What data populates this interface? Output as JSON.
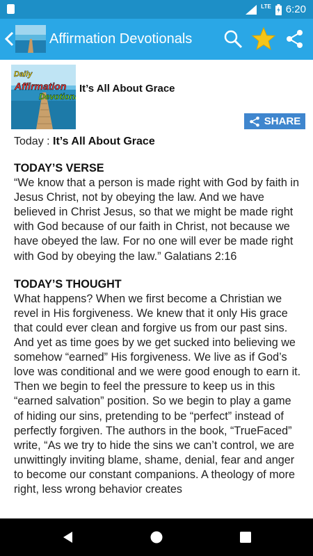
{
  "status_bar": {
    "network": "LTE",
    "time": "6:20"
  },
  "app_bar": {
    "title": "Affirmation Devotionals"
  },
  "logo": {
    "line1": "Daily",
    "line2": "Affirmation",
    "line3": "Devotional"
  },
  "header": {
    "title": "It’s All About Grace",
    "share_label": "SHARE"
  },
  "today": {
    "prefix": "Today : ",
    "title": "It’s All About Grace"
  },
  "verse": {
    "heading": "TODAY’S VERSE",
    "text": "“We know that a person is made right with God by faith in Jesus Christ, not by obeying the law. And we have believed in Christ Jesus, so that we might be made right with God because of our faith in Christ, not because we have obeyed the law. For no one will ever be made right with God by obeying the law.” Galatians 2:16"
  },
  "thought": {
    "heading": "TODAY’S THOUGHT",
    "text": "What happens? When we first become a Christian we revel in His forgiveness. We knew that it only His grace that could ever clean and forgive us from our past sins. And yet as time goes by we get sucked into believing we somehow “earned” His forgiveness. We live as if God’s love was conditional and we were good enough to earn it. Then we begin to feel the pressure to keep us in this “earned salvation” position. So we begin to play a game of hiding our sins, pretending to be “perfect” instead of perfectly forgiven. The authors in the book, “TrueFaced” write, “As we try to hide the sins we can’t control, we are unwittingly inviting blame, shame, denial, fear and anger to become our constant companions. A theology of more right, less wrong behavior creates"
  },
  "icons": {
    "back": "back-arrow-icon",
    "search": "search-icon",
    "favorite": "star-icon",
    "share": "share-icon",
    "nav_back": "nav-back-icon",
    "nav_home": "nav-home-icon",
    "nav_recents": "nav-recents-icon"
  },
  "colors": {
    "status_bar": "#1d8fc7",
    "app_bar": "#2aa7e6",
    "star": "#f5c518",
    "share_button": "#3f86ce",
    "nav_bar": "#000000"
  }
}
